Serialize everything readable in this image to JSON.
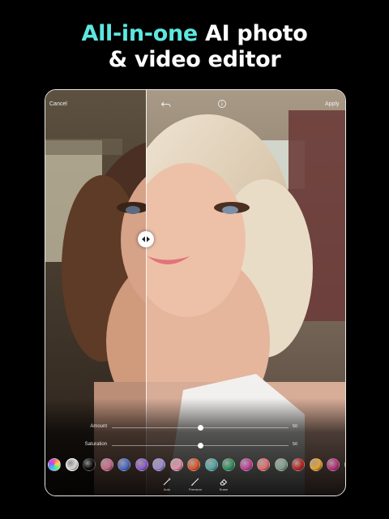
{
  "headline": {
    "line1_accent": "All-in-one",
    "line1_rest": " AI photo",
    "line2": "& video editor"
  },
  "editor": {
    "cancel_label": "Cancel",
    "apply_label": "Apply",
    "sliders": [
      {
        "label": "Amount",
        "value": "50",
        "level": 0.5
      },
      {
        "label": "Saturation",
        "value": "50",
        "level": 0.5
      }
    ],
    "swatches": [
      {
        "name": "rainbow",
        "color": "#ff4da6"
      },
      {
        "name": "silver",
        "color": "#d8d8d8"
      },
      {
        "name": "black",
        "color": "#0b0b0b"
      },
      {
        "name": "rose",
        "color": "#c96a8a"
      },
      {
        "name": "blue",
        "color": "#4a6ac9"
      },
      {
        "name": "violet",
        "color": "#8d5ccf"
      },
      {
        "name": "lavender",
        "color": "#9b8bd6"
      },
      {
        "name": "pink",
        "color": "#e88da8"
      },
      {
        "name": "orange",
        "color": "#e0552a"
      },
      {
        "name": "teal",
        "color": "#4fa8a6"
      },
      {
        "name": "emerald",
        "color": "#2f8f5c"
      },
      {
        "name": "magenta",
        "color": "#c23f98"
      },
      {
        "name": "coral",
        "color": "#e56b6b"
      },
      {
        "name": "sage",
        "color": "#7fa08a"
      },
      {
        "name": "crimson",
        "color": "#b9231f"
      },
      {
        "name": "amber",
        "color": "#e8a227"
      },
      {
        "name": "berry",
        "color": "#b8307c"
      },
      {
        "name": "gold",
        "color": "#caa25a"
      }
    ],
    "tools": [
      {
        "icon": "magic-wand-icon",
        "label": "Auto"
      },
      {
        "icon": "brush-icon",
        "label": "Premium"
      },
      {
        "icon": "eraser-icon",
        "label": "Erase"
      }
    ]
  },
  "colors": {
    "accent": "#5ee7df",
    "background": "#000000"
  }
}
